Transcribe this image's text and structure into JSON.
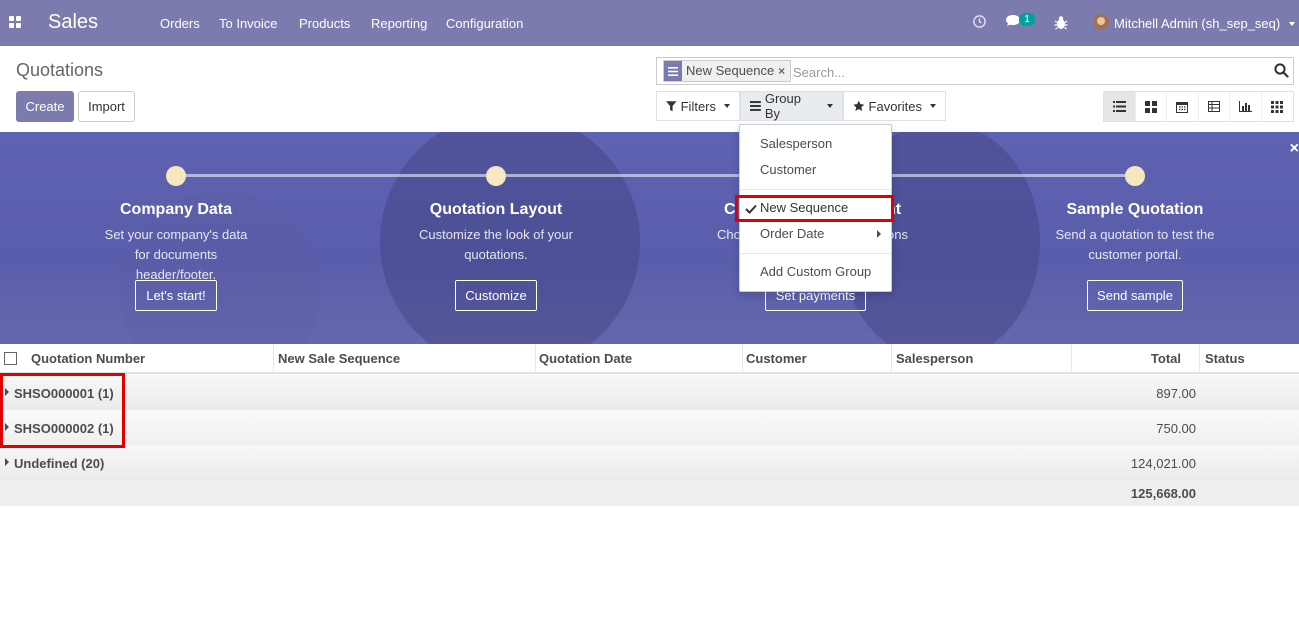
{
  "navbar": {
    "app_name": "Sales",
    "menu": [
      "Orders",
      "To Invoice",
      "Products",
      "Reporting",
      "Configuration"
    ],
    "message_count": "1",
    "user": "Mitchell Admin (sh_sep_seq)"
  },
  "breadcrumb": "Quotations",
  "buttons": {
    "create": "Create",
    "import": "Import"
  },
  "search": {
    "facet_label": "New Sequence",
    "facet_close": "×",
    "placeholder": "Search..."
  },
  "controls": {
    "filters": "Filters",
    "group_by": "Group By",
    "favorites": "Favorites"
  },
  "groupby_menu": {
    "items": [
      "Salesperson",
      "Customer",
      "New Sequence",
      "Order Date",
      "Add Custom Group"
    ],
    "checked": "New Sequence"
  },
  "banner": {
    "steps": [
      {
        "title": "Company Data",
        "desc": "Set your company's data for documents header/footer.",
        "button": "Let's start!"
      },
      {
        "title": "Quotation Layout",
        "desc": "Customize the look of your quotations.",
        "button": "Customize"
      },
      {
        "title": "C",
        "title_suffix": "nt",
        "desc": "Cho",
        "desc_suffix": "ons",
        "button": "Set payments"
      },
      {
        "title": "Sample Quotation",
        "desc": "Send a quotation to test the customer portal.",
        "button": "Send sample"
      }
    ],
    "close": "×"
  },
  "table": {
    "headers": [
      "Quotation Number",
      "New Sale Sequence",
      "Quotation Date",
      "Customer",
      "Salesperson",
      "Total",
      "Status"
    ],
    "groups": [
      {
        "name": "SHSO000001 (1)",
        "total": "897.00"
      },
      {
        "name": "SHSO000002 (1)",
        "total": "750.00"
      },
      {
        "name": "Undefined (20)",
        "total": "124,021.00"
      }
    ],
    "grand_total": "125,668.00"
  },
  "colors": {
    "brand": "#7c7bad",
    "highlight": "#e00000"
  }
}
